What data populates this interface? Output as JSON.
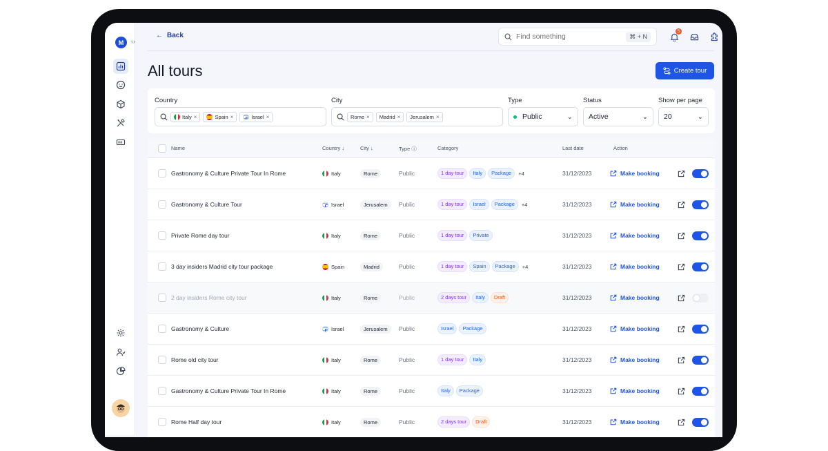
{
  "topbar": {
    "back_label": "Back",
    "search_placeholder": "Find something",
    "search_shortcut": "⌘ + N",
    "notification_count": "5"
  },
  "header": {
    "title": "All tours",
    "create_label": "Create tour"
  },
  "filters": {
    "country": {
      "label": "Country",
      "chips": [
        {
          "flag": "it",
          "text": "Italy"
        },
        {
          "flag": "es",
          "text": "Spain"
        },
        {
          "flag": "il",
          "text": "Israel"
        }
      ]
    },
    "city": {
      "label": "City",
      "chips": [
        "Rome",
        "Madrid",
        "Jerusalem"
      ]
    },
    "type": {
      "label": "Type",
      "value": "Public"
    },
    "status": {
      "label": "Status",
      "value": "Active"
    },
    "per_page": {
      "label": "Show per page",
      "value": "20"
    }
  },
  "table": {
    "headers": {
      "name": "Name",
      "country": "Country",
      "city": "City",
      "type": "Type",
      "category": "Category",
      "last_date": "Last date",
      "action": "Action"
    },
    "action_label": "Make booking",
    "rows": [
      {
        "name": "Gastronomy & Culture Private Tour In Rome",
        "flag": "it",
        "country": "Italy",
        "city": "Rome",
        "type": "Public",
        "tags": [
          [
            "1 day tour",
            "purple"
          ],
          [
            "Italy",
            "blue"
          ],
          [
            "Package",
            "blue"
          ]
        ],
        "more": "+4",
        "date": "31/12/2023",
        "active": true,
        "draft": false
      },
      {
        "name": "Gastronomy & Culture Tour",
        "flag": "il",
        "country": "Israel",
        "city": "Jerusalem",
        "type": "Public",
        "tags": [
          [
            "1 day tour",
            "purple"
          ],
          [
            "Israel",
            "blue"
          ],
          [
            "Package",
            "blue"
          ]
        ],
        "more": "+4",
        "date": "31/12/2023",
        "active": true,
        "draft": false
      },
      {
        "name": "Private Rome day tour",
        "flag": "it",
        "country": "Italy",
        "city": "Rome",
        "type": "Public",
        "tags": [
          [
            "1 day tour",
            "purple"
          ],
          [
            "Private",
            "blue"
          ]
        ],
        "more": "",
        "date": "31/12/2023",
        "active": true,
        "draft": false
      },
      {
        "name": "3 day insiders Madrid city tour package",
        "flag": "es",
        "country": "Spain",
        "city": "Madrid",
        "type": "Public",
        "tags": [
          [
            "1 day tour",
            "purple"
          ],
          [
            "Spain",
            "blue"
          ],
          [
            "Package",
            "blue"
          ]
        ],
        "more": "+4",
        "date": "31/12/2023",
        "active": true,
        "draft": false
      },
      {
        "name": "2 day insiders Rome city tour",
        "flag": "it",
        "country": "Italy",
        "city": "Rome",
        "type": "Public",
        "tags": [
          [
            "2 days tour",
            "purple"
          ],
          [
            "Italy",
            "blue"
          ],
          [
            "Draft",
            "orange"
          ]
        ],
        "more": "",
        "date": "31/12/2023",
        "active": false,
        "draft": true
      },
      {
        "name": "Gastronomy & Culture",
        "flag": "il",
        "country": "Israel",
        "city": "Jerusalem",
        "type": "Public",
        "tags": [
          [
            "Israel",
            "blue"
          ],
          [
            "Package",
            "blue"
          ]
        ],
        "more": "",
        "date": "31/12/2023",
        "active": true,
        "draft": false
      },
      {
        "name": "Rome old city tour",
        "flag": "it",
        "country": "Italy",
        "city": "Rome",
        "type": "Public",
        "tags": [
          [
            "1 day tour",
            "purple"
          ],
          [
            "Italy",
            "blue"
          ]
        ],
        "more": "",
        "date": "31/12/2023",
        "active": true,
        "draft": false
      },
      {
        "name": "Gastronomy & Culture Private Tour In Rome",
        "flag": "it",
        "country": "Italy",
        "city": "Rome",
        "type": "Public",
        "tags": [
          [
            "Italy",
            "blue"
          ],
          [
            "Package",
            "blue"
          ]
        ],
        "more": "",
        "date": "31/12/2023",
        "active": true,
        "draft": false
      },
      {
        "name": "Rome Half day tour",
        "flag": "it",
        "country": "Italy",
        "city": "Rome",
        "type": "Public",
        "tags": [
          [
            "2 days tour",
            "purple"
          ],
          [
            "Draft",
            "orange"
          ]
        ],
        "more": "",
        "date": "31/12/2023",
        "active": true,
        "draft": false
      }
    ]
  }
}
